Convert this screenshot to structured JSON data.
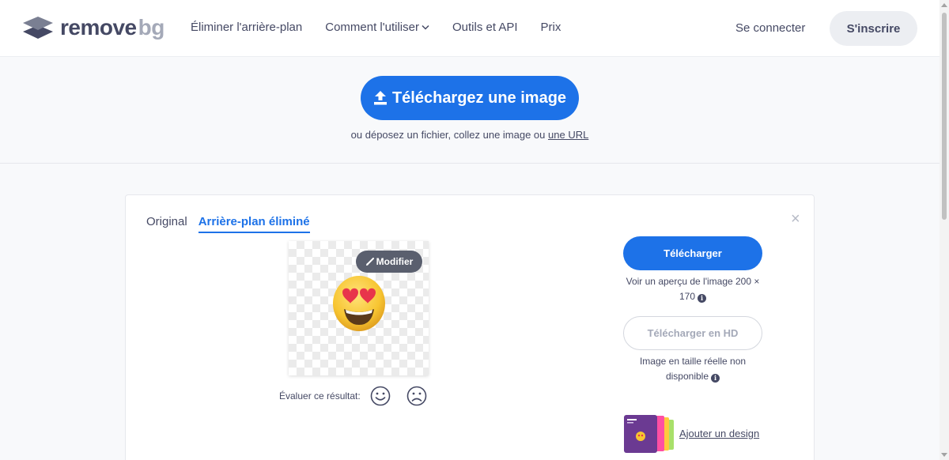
{
  "header": {
    "logo": {
      "text_main": "remove",
      "text_accent": "bg"
    },
    "nav": [
      {
        "label": "Éliminer l'arrière-plan"
      },
      {
        "label": "Comment l'utiliser",
        "has_dropdown": true
      },
      {
        "label": "Outils et API"
      },
      {
        "label": "Prix"
      }
    ],
    "login_label": "Se connecter",
    "signup_label": "S'inscrire"
  },
  "upload": {
    "button_label": "Téléchargez une image",
    "sub_text": "ou déposez un fichier, collez une image ou",
    "url_link": "une URL"
  },
  "result": {
    "tabs": [
      {
        "label": "Original",
        "active": false
      },
      {
        "label": "Arrière-plan éliminé",
        "active": true
      }
    ],
    "close_icon": "×",
    "modify_label": "Modifier",
    "rate_label": "Évaluer ce résultat:",
    "download": {
      "button_label": "Télécharger",
      "sub_text": "Voir un aperçu de l'image 200 × 170"
    },
    "download_hd": {
      "button_label": "Télécharger en HD",
      "sub_text": "Image en taille réelle non disponible"
    },
    "design_link": "Ajouter un design"
  },
  "colors": {
    "primary": "#1d72e8",
    "text": "#454964",
    "muted": "#a4a9b8",
    "badge": "#5a5f6e"
  },
  "icons": {
    "logo": "stacked-layers-icon",
    "nav_chevron": "chevron-down-icon",
    "upload": "upload-arrow-icon",
    "modify": "brush-icon",
    "close": "close-icon",
    "info": "info-icon",
    "happy": "smiley-face-icon",
    "sad": "frowning-face-icon",
    "preview_emoji": "heart-eyes-emoji"
  }
}
